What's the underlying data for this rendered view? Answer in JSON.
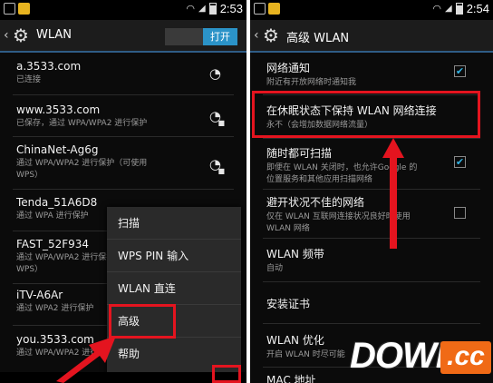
{
  "left": {
    "status": {
      "time": "2:53"
    },
    "header": {
      "title": "WLAN",
      "toggle": "打开"
    },
    "networks": [
      {
        "ssid": "a.3533.com",
        "status": "已连接",
        "locked": false
      },
      {
        "ssid": "www.3533.com",
        "status": "已保存，通过 WPA/WPA2 进行保护",
        "locked": true
      },
      {
        "ssid": "ChinaNet-Ag6g",
        "status": "通过 WPA/WPA2 进行保护（可使用",
        "status2": "WPS）",
        "locked": true
      },
      {
        "ssid": "Tenda_51A6D8",
        "status": "通过 WPA 进行保护",
        "locked": true
      },
      {
        "ssid": "FAST_52F934",
        "status": "通过 WPA/WPA2 进行保护（可使用",
        "status2": "WPS）",
        "locked": true
      },
      {
        "ssid": "iTV-A6Ar",
        "status": "通过 WPA2 进行保护",
        "locked": true
      },
      {
        "ssid": "you.3533.com",
        "status": "通过 WPA/WPA2 进行保护",
        "locked": true
      }
    ],
    "menu": [
      "扫描",
      "WPS PIN 输入",
      "WLAN 直连",
      "高级",
      "帮助"
    ]
  },
  "right": {
    "status": {
      "time": "2:54"
    },
    "header": {
      "title": "高级 WLAN"
    },
    "settings": [
      {
        "title": "网络通知",
        "subtitle": "附近有开放网络时通知我",
        "checkbox": true
      },
      {
        "title": "在休眠状态下保持 WLAN 网络连接",
        "subtitle": "永不（会增加数据网络流量）"
      },
      {
        "title": "随时都可扫描",
        "subtitle": "即便在 WLAN 关闭时，也允许Google 的",
        "subtitle2": "位置服务和其他应用扫描网络",
        "checkbox": true
      },
      {
        "title": "避开状况不佳的网络",
        "subtitle": "仅在 WLAN 互联网连接状况良好时使用",
        "subtitle2": "WLAN 网络",
        "checkbox": false
      },
      {
        "title": "WLAN 频带",
        "subtitle": "自动"
      },
      {
        "title": "安装证书"
      },
      {
        "title": "WLAN 优化",
        "subtitle": "开启 WLAN 时尽可能"
      },
      {
        "title": "MAC 地址"
      }
    ]
  },
  "watermark": {
    "brand": "DOWN",
    "suffix": ".cc"
  },
  "colors": {
    "highlight": "#e4141f",
    "accent": "#2b93c8",
    "watermark": "#f06a16"
  }
}
